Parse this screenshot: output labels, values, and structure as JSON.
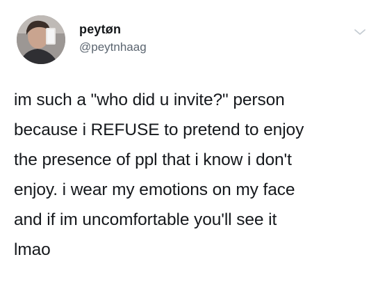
{
  "tweet": {
    "author": {
      "display_name": "peytøn",
      "handle": "@peytnhaag",
      "avatar_icon": "profile-photo"
    },
    "menu_icon": "chevron-down-icon",
    "text": "im such a \"who did u invite?\" person\nbecause i REFUSE to pretend to enjoy\nthe presence of ppl that i know i don't\nenjoy. i wear my emotions on my face\nand if im uncomfortable you'll see it\nlmao",
    "colors": {
      "text": "#15181c",
      "handle": "#5b6570",
      "chevron": "#c4cbd2"
    }
  }
}
